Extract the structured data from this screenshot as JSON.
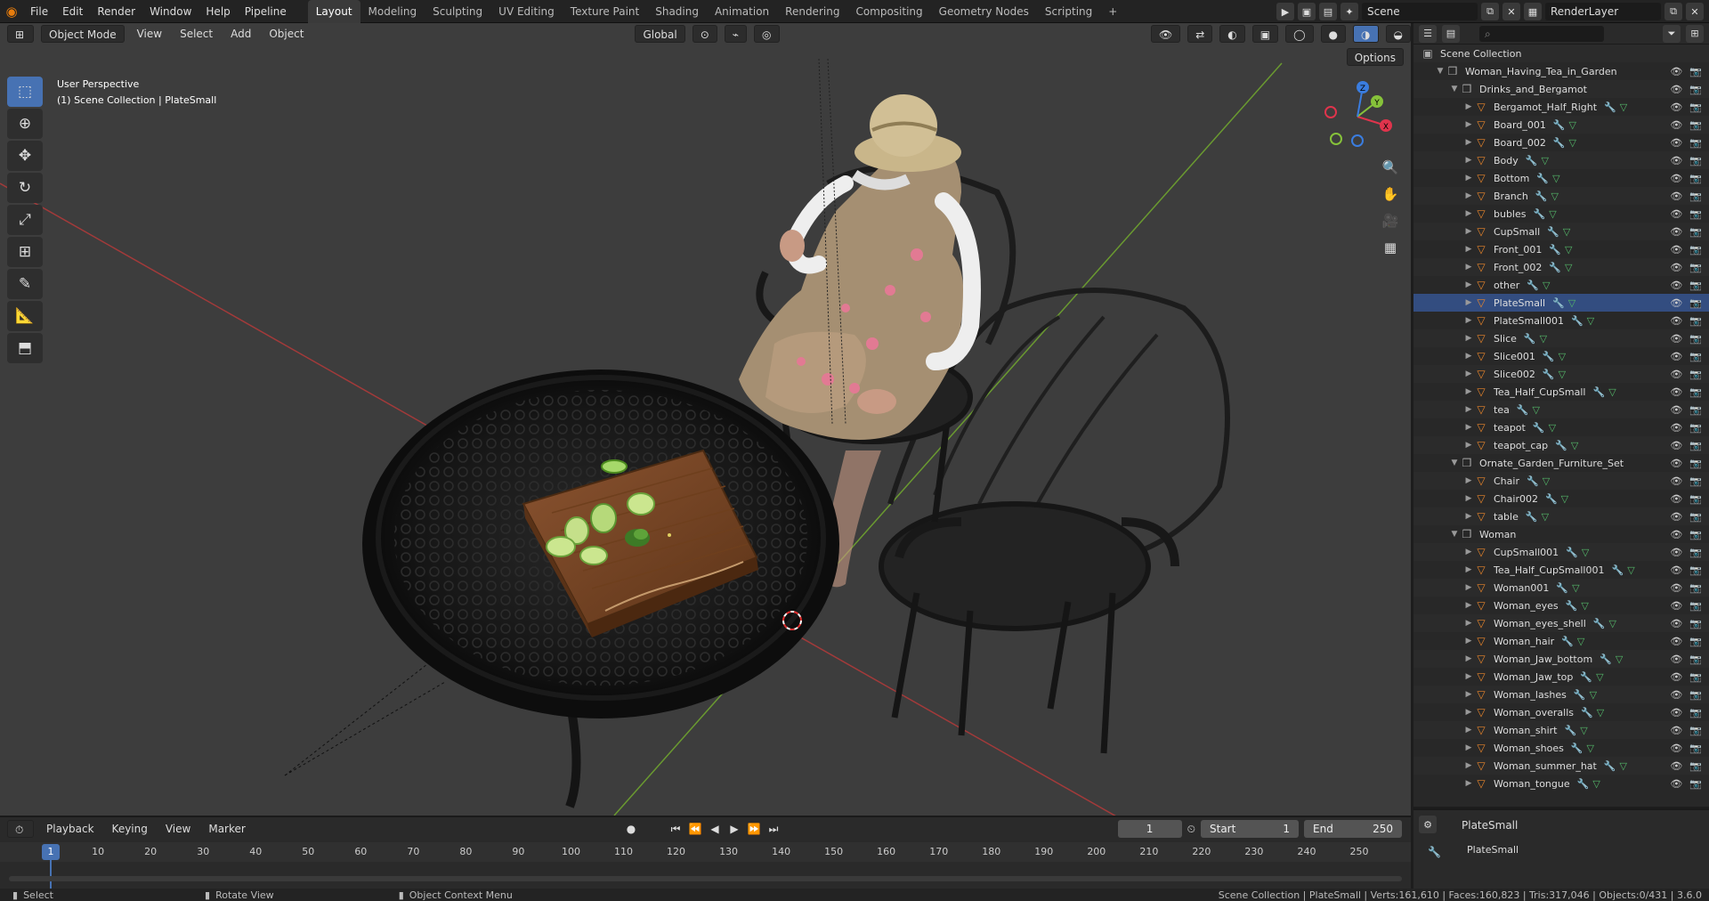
{
  "app": {
    "menus": [
      "File",
      "Edit",
      "Render",
      "Window",
      "Help",
      "Pipeline"
    ],
    "workspaces": [
      "Layout",
      "Modeling",
      "Sculpting",
      "UV Editing",
      "Texture Paint",
      "Shading",
      "Animation",
      "Rendering",
      "Compositing",
      "Geometry Nodes",
      "Scripting",
      "+"
    ],
    "active_workspace": "Layout",
    "scene": "Scene",
    "view_layer": "RenderLayer"
  },
  "viewport": {
    "mode": "Object Mode",
    "menus": [
      "View",
      "Select",
      "Add",
      "Object"
    ],
    "orientation": "Global",
    "options": "Options",
    "info_line1": "User Perspective",
    "info_line2": "(1) Scene Collection | PlateSmall",
    "gizmo_axes": [
      "X",
      "Y",
      "Z"
    ]
  },
  "outliner": {
    "root": "Scene Collection",
    "rows": [
      {
        "label": "Woman_Having_Tea_in_Garden",
        "type": "coll",
        "depth": 1,
        "expanded": true
      },
      {
        "label": "Drinks_and_Bergamot",
        "type": "coll",
        "depth": 2,
        "expanded": true
      },
      {
        "label": "Bergamot_Half_Right",
        "type": "obj",
        "depth": 3
      },
      {
        "label": "Board_001",
        "type": "obj",
        "depth": 3
      },
      {
        "label": "Board_002",
        "type": "obj",
        "depth": 3
      },
      {
        "label": "Body",
        "type": "obj",
        "depth": 3
      },
      {
        "label": "Bottom",
        "type": "obj",
        "depth": 3
      },
      {
        "label": "Branch",
        "type": "obj",
        "depth": 3
      },
      {
        "label": "bubles",
        "type": "obj",
        "depth": 3
      },
      {
        "label": "CupSmall",
        "type": "obj",
        "depth": 3
      },
      {
        "label": "Front_001",
        "type": "obj",
        "depth": 3
      },
      {
        "label": "Front_002",
        "type": "obj",
        "depth": 3
      },
      {
        "label": "other",
        "type": "obj",
        "depth": 3
      },
      {
        "label": "PlateSmall",
        "type": "obj",
        "depth": 3,
        "active": true
      },
      {
        "label": "PlateSmall001",
        "type": "obj",
        "depth": 3
      },
      {
        "label": "Slice",
        "type": "obj",
        "depth": 3
      },
      {
        "label": "Slice001",
        "type": "obj",
        "depth": 3
      },
      {
        "label": "Slice002",
        "type": "obj",
        "depth": 3
      },
      {
        "label": "Tea_Half_CupSmall",
        "type": "obj",
        "depth": 3
      },
      {
        "label": "tea",
        "type": "obj",
        "depth": 3
      },
      {
        "label": "teapot",
        "type": "obj",
        "depth": 3
      },
      {
        "label": "teapot_cap",
        "type": "obj",
        "depth": 3
      },
      {
        "label": "Ornate_Garden_Furniture_Set",
        "type": "coll",
        "depth": 2,
        "expanded": true
      },
      {
        "label": "Chair",
        "type": "obj",
        "depth": 3
      },
      {
        "label": "Chair002",
        "type": "obj",
        "depth": 3
      },
      {
        "label": "table",
        "type": "obj",
        "depth": 3
      },
      {
        "label": "Woman",
        "type": "coll",
        "depth": 2,
        "expanded": true
      },
      {
        "label": "CupSmall001",
        "type": "obj",
        "depth": 3
      },
      {
        "label": "Tea_Half_CupSmall001",
        "type": "obj",
        "depth": 3
      },
      {
        "label": "Woman001",
        "type": "obj",
        "depth": 3
      },
      {
        "label": "Woman_eyes",
        "type": "obj",
        "depth": 3
      },
      {
        "label": "Woman_eyes_shell",
        "type": "obj",
        "depth": 3
      },
      {
        "label": "Woman_hair",
        "type": "obj",
        "depth": 3
      },
      {
        "label": "Woman_Jaw_bottom",
        "type": "obj",
        "depth": 3
      },
      {
        "label": "Woman_Jaw_top",
        "type": "obj",
        "depth": 3
      },
      {
        "label": "Woman_lashes",
        "type": "obj",
        "depth": 3
      },
      {
        "label": "Woman_overalls",
        "type": "obj",
        "depth": 3
      },
      {
        "label": "Woman_shirt",
        "type": "obj",
        "depth": 3
      },
      {
        "label": "Woman_shoes",
        "type": "obj",
        "depth": 3
      },
      {
        "label": "Woman_summer_hat",
        "type": "obj",
        "depth": 3
      },
      {
        "label": "Woman_tongue",
        "type": "obj",
        "depth": 3
      }
    ]
  },
  "properties": {
    "object_name": "PlateSmall",
    "sub_name": "PlateSmall"
  },
  "timeline": {
    "menus": [
      "Playback",
      "Keying",
      "View",
      "Marker"
    ],
    "current_frame": "1",
    "start_label": "Start",
    "start": "1",
    "end_label": "End",
    "end": "250",
    "ticks": [
      "1",
      "10",
      "20",
      "30",
      "40",
      "50",
      "60",
      "70",
      "80",
      "90",
      "100",
      "110",
      "120",
      "130",
      "140",
      "150",
      "160",
      "170",
      "180",
      "190",
      "200",
      "210",
      "220",
      "230",
      "240",
      "250"
    ]
  },
  "status": {
    "select": "Select",
    "rotate": "Rotate View",
    "context": "Object Context Menu",
    "stats": "Scene Collection | PlateSmall | Verts:161,610 | Faces:160,823 | Tris:317,046 | Objects:0/431 | 3.6.0"
  },
  "colors": {
    "accent": "#4772b3",
    "object_icon": "#e8852b",
    "collection_icon": "#aaaaaa",
    "mesh_icon": "#54b96a",
    "modifier_icon": "#7aa0e0",
    "axis_x": "#e0344c",
    "axis_y": "#86c23a",
    "axis_z": "#3a7de0"
  }
}
